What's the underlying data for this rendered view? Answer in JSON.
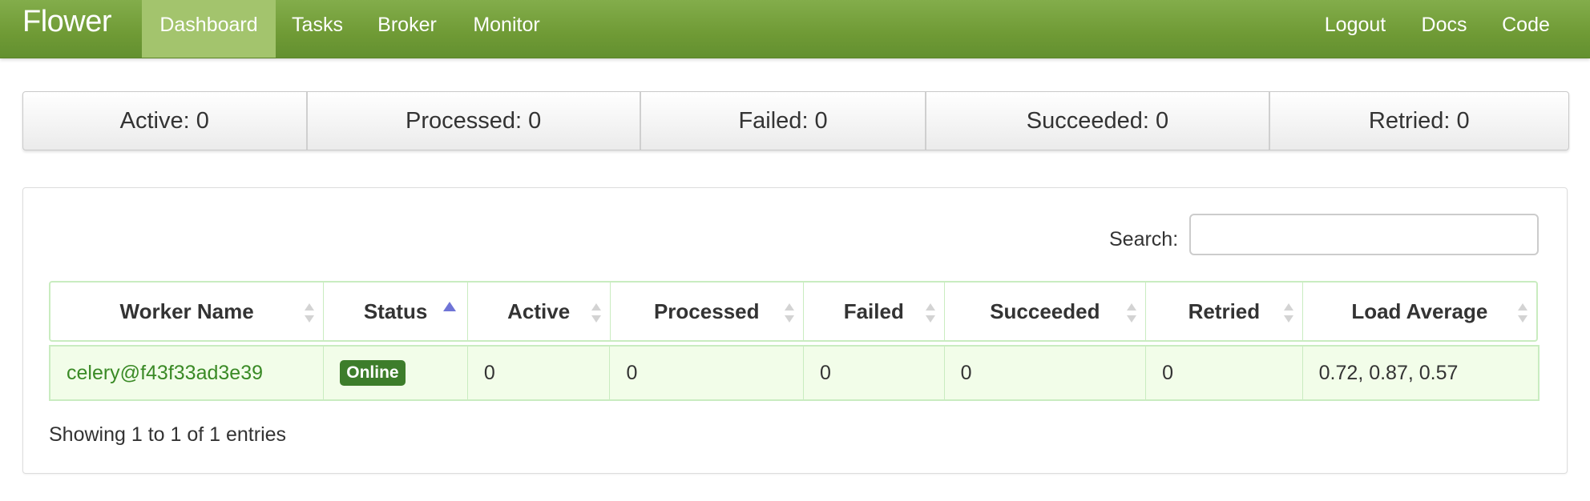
{
  "navbar": {
    "brand": "Flower",
    "left_items": [
      {
        "label": "Dashboard",
        "active": true
      },
      {
        "label": "Tasks"
      },
      {
        "label": "Broker"
      },
      {
        "label": "Monitor"
      }
    ],
    "right_items": [
      {
        "label": "Logout"
      },
      {
        "label": "Docs"
      },
      {
        "label": "Code"
      }
    ]
  },
  "stats": [
    {
      "label": "Active: 0"
    },
    {
      "label": "Processed: 0"
    },
    {
      "label": "Failed: 0"
    },
    {
      "label": "Succeeded: 0"
    },
    {
      "label": "Retried: 0"
    }
  ],
  "search": {
    "label": "Search:",
    "value": "",
    "placeholder": ""
  },
  "table": {
    "columns": [
      "Worker Name",
      "Status",
      "Active",
      "Processed",
      "Failed",
      "Succeeded",
      "Retried",
      "Load Average"
    ],
    "sorted_column": "Status",
    "rows": [
      {
        "worker_name": "celery@f43f33ad3e39",
        "status": "Online",
        "active": "0",
        "processed": "0",
        "failed": "0",
        "succeeded": "0",
        "retried": "0",
        "load_average": "0.72, 0.87, 0.57"
      }
    ],
    "info": "Showing 1 to 1 of 1 entries"
  },
  "colors": {
    "navbar": "#6f9a35",
    "nav_active": "#a3c46d",
    "link": "#3a8a26",
    "badge": "#3d7d2b",
    "row_bg": "#f2fde9",
    "table_border": "#c9ecc0",
    "sort_active": "#6f74d6"
  }
}
